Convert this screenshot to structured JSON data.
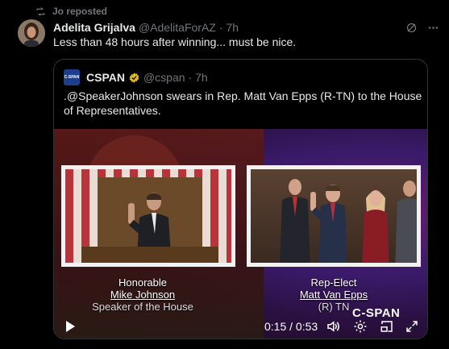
{
  "repost": {
    "label": "Jo reposted",
    "icon": "repost-icon"
  },
  "tweet": {
    "author_name": "Adelita Grijalva",
    "author_handle": "@AdelitaForAZ",
    "time": "· 7h",
    "text": "Less than 48 hours after winning... must be nice."
  },
  "quote": {
    "logo_text": "C-SPAN",
    "author_name": "CSPAN",
    "author_handle": "@cspan",
    "time": "· 7h",
    "text": ".@SpeakerJohnson swears in Rep. Matt Van Epps (R-TN) to the House of Representatives."
  },
  "video": {
    "caption_left": {
      "line1": "Honorable",
      "line2": "Mike Johnson",
      "line3": "Speaker of the House"
    },
    "caption_right": {
      "line1": "Rep-Elect",
      "line2": "Matt Van Epps",
      "line3": "(R)  TN"
    },
    "network_bug": "C-SPAN",
    "time_readout": "0:15 / 0:53"
  },
  "colors": {
    "background": "#000000",
    "text": "#e7e9ea",
    "muted": "#71767b",
    "verified_gold": "#e2b719",
    "cspan_blue": "#1d3d8f"
  }
}
